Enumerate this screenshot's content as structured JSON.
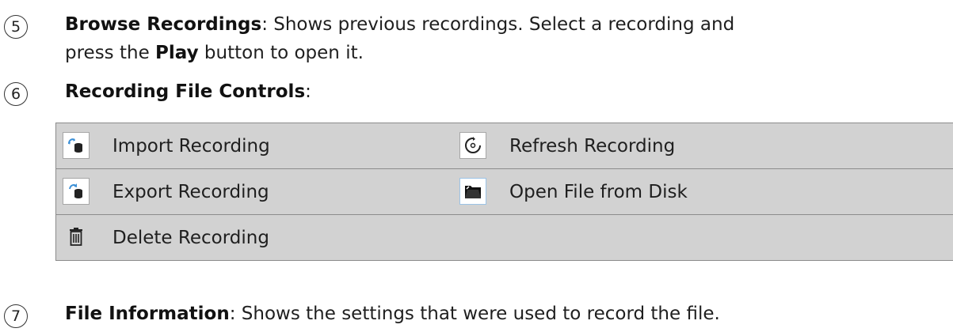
{
  "step5": {
    "number": "5",
    "title": "Browse Recordings",
    "text_before_play": ": Shows previous recordings. Select a recording and",
    "line2_prefix": "press the ",
    "play_label": "Play",
    "line2_suffix": " button to open it."
  },
  "step6": {
    "number": "6",
    "title": "Recording File Controls",
    "colon": ":"
  },
  "controls": [
    [
      {
        "icon": "import-recording-icon",
        "label": "Import Recording"
      },
      {
        "icon": "refresh-recording-icon",
        "label": "Refresh Recording"
      }
    ],
    [
      {
        "icon": "export-recording-icon",
        "label": "Export Recording"
      },
      {
        "icon": "open-folder-icon",
        "label": "Open File from Disk"
      }
    ],
    [
      {
        "icon": "trash-icon",
        "label": "Delete Recording"
      }
    ]
  ],
  "step7": {
    "number": "7",
    "title": "File Information",
    "text": ": Shows the settings that were used to record the file."
  },
  "colors": {
    "table_background": "#d2d2d2",
    "table_border": "#8c8c8c",
    "icon_blue": "#3b8fd6"
  }
}
